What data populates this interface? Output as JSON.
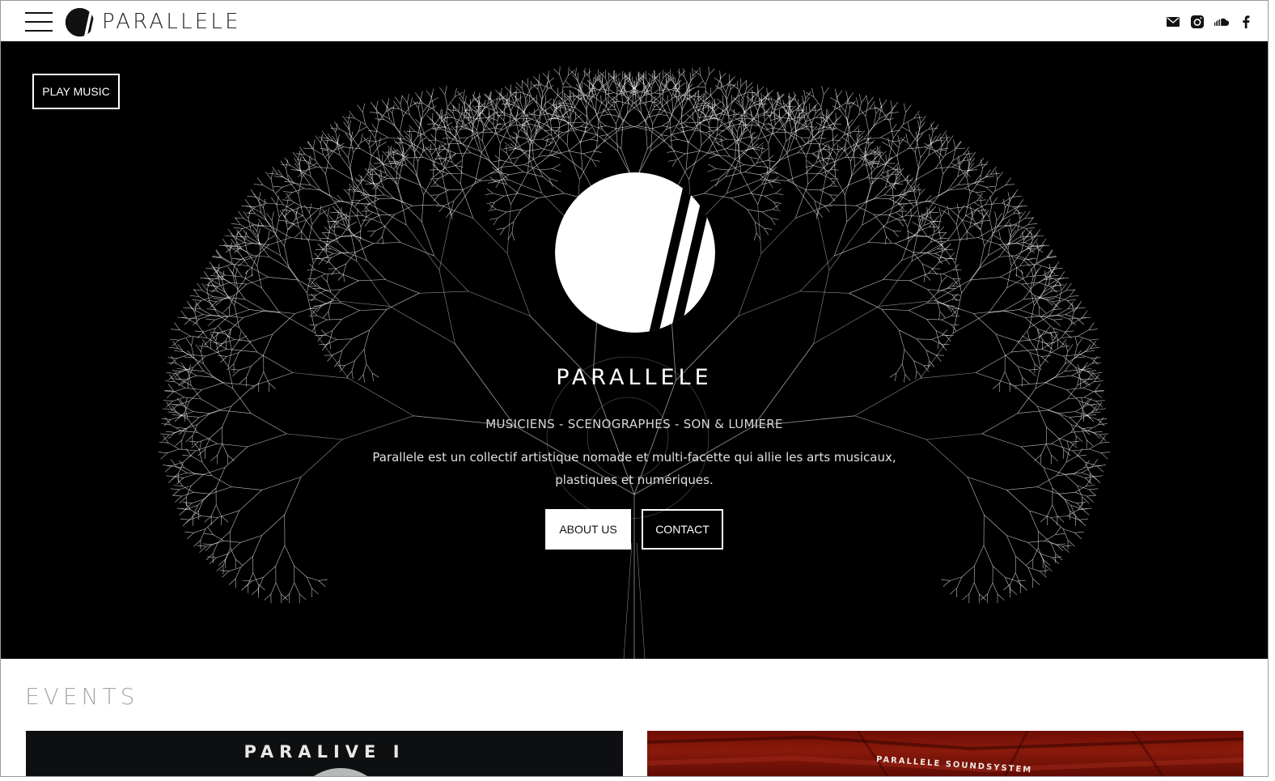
{
  "header": {
    "brand_name": "PARALLELE",
    "social": [
      {
        "icon": "mail-icon"
      },
      {
        "icon": "instagram-icon"
      },
      {
        "icon": "soundcloud-icon"
      },
      {
        "icon": "facebook-icon"
      }
    ]
  },
  "hero": {
    "play_label": "PLAY MUSIC",
    "title": "PARALLELE",
    "subtitle": "MUSICIENS - SCENOGRAPHES - SON & LUMIERE",
    "description": "Parallele est un collectif artistique nomade et multi-facette qui allie les arts musicaux, plastiques et numériques.",
    "about_label": "ABOUT US",
    "contact_label": "CONTACT"
  },
  "events": {
    "title": "EVENTS",
    "cards": [
      {
        "title": "PARALIVE I"
      },
      {
        "title": "PARALLELE SOUNDSYSTEM"
      }
    ]
  },
  "colors": {
    "hero_bg": "#000000",
    "header_bg": "#ffffff",
    "accent": "#ffffff",
    "events_title": "#a8a8a8"
  }
}
